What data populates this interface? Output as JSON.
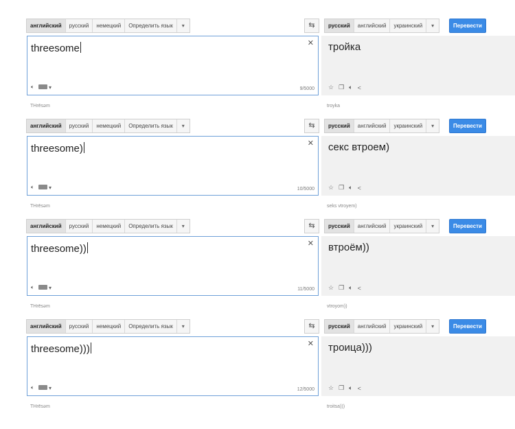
{
  "source_languages": [
    "английский",
    "русский",
    "немецкий",
    "Определить язык"
  ],
  "target_languages": [
    "русский",
    "английский",
    "украинский"
  ],
  "dropdown_arrow": "▾",
  "translate_label": "Перевести",
  "icons": {
    "swap": "swap-languages-icon",
    "clear": "clear-icon",
    "sound": "sound-icon",
    "keyboard": "keyboard-icon",
    "star": "star-icon",
    "copy": "copy-icon",
    "share": "share-icon"
  },
  "panels": [
    {
      "source_text": "threesome",
      "char_count": "9/5000",
      "translation": "тройка",
      "source_translit": "THrēsəm",
      "target_translit": "troyka"
    },
    {
      "source_text": "threesome)",
      "char_count": "10/5000",
      "translation": "секс втроем)",
      "source_translit": "THrēsəm",
      "target_translit": "seks vtroyem)"
    },
    {
      "source_text": "threesome))",
      "char_count": "11/5000",
      "translation": "втроём))",
      "source_translit": "THrēsəm",
      "target_translit": "vtroyom))"
    },
    {
      "source_text": "threesome)))",
      "char_count": "12/5000",
      "translation": "троица)))",
      "source_translit": "THrēsəm",
      "target_translit": "troitsa)))"
    }
  ]
}
